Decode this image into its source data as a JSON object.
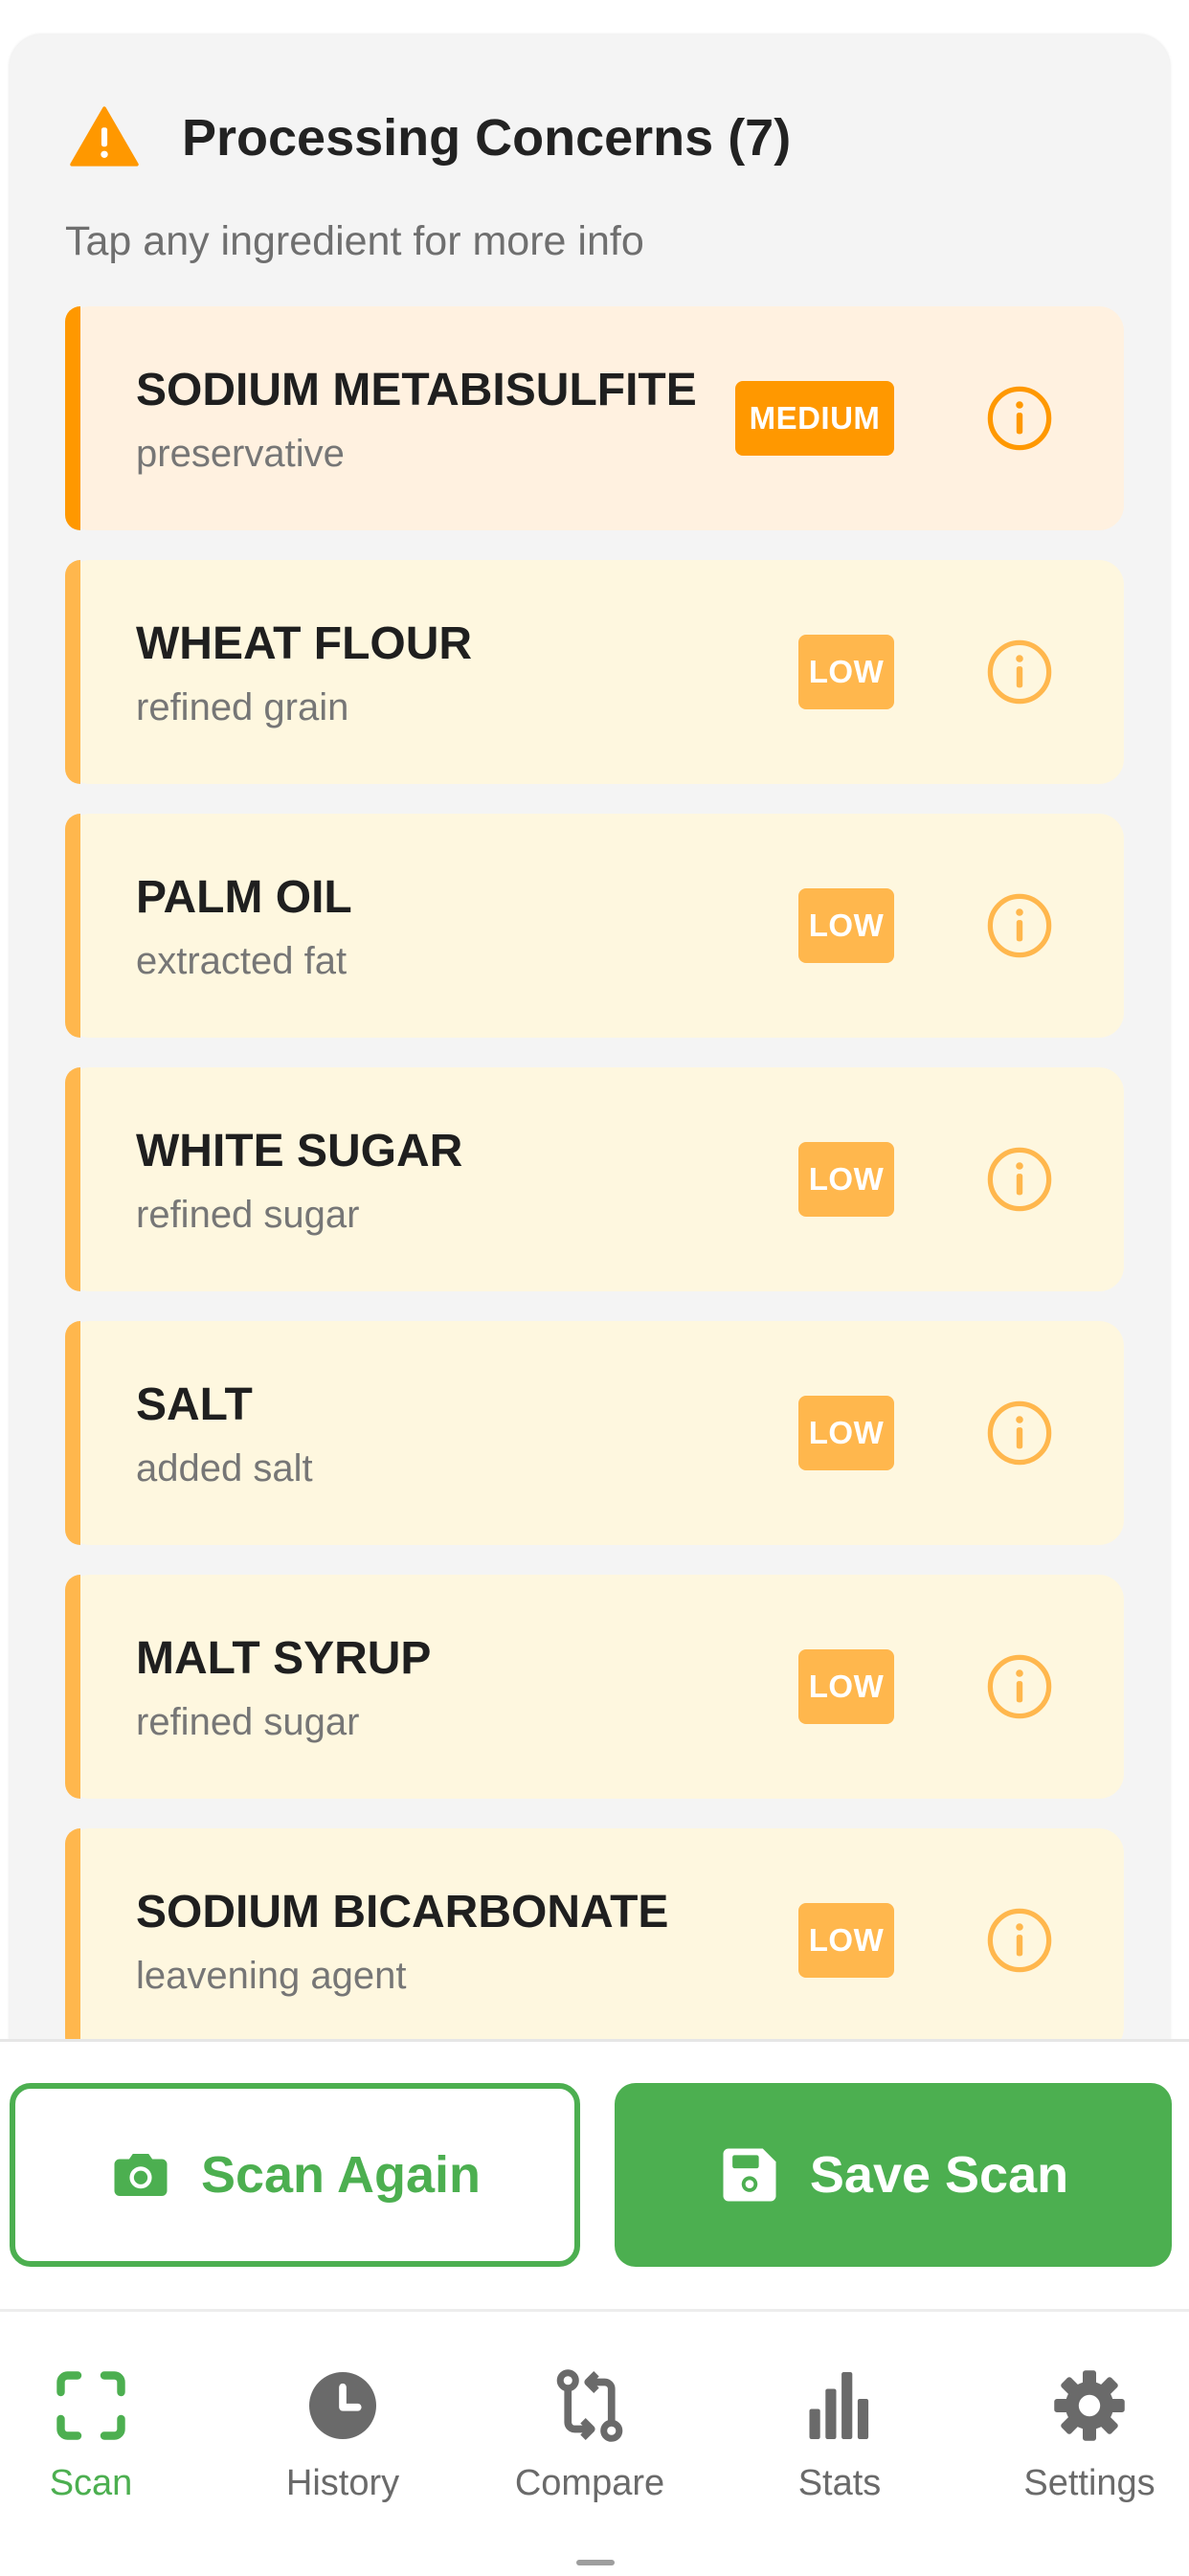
{
  "colors": {
    "accent_green": "#4caf50",
    "medium_orange": "#ff9800",
    "low_amber": "#ffb74d",
    "medium_bg": "#fff1e0",
    "low_bg": "#fef7df",
    "nav_inactive": "#6a6a6a"
  },
  "concerns": {
    "title": "Processing Concerns (7)",
    "subtitle": "Tap any ingredient for more info",
    "items": [
      {
        "name": "SODIUM METABISULFITE",
        "category": "preservative",
        "level": "MEDIUM"
      },
      {
        "name": "WHEAT FLOUR",
        "category": "refined grain",
        "level": "LOW"
      },
      {
        "name": "PALM OIL",
        "category": "extracted fat",
        "level": "LOW"
      },
      {
        "name": "WHITE SUGAR",
        "category": "refined sugar",
        "level": "LOW"
      },
      {
        "name": "SALT",
        "category": "added salt",
        "level": "LOW"
      },
      {
        "name": "MALT SYRUP",
        "category": "refined sugar",
        "level": "LOW"
      },
      {
        "name": "SODIUM BICARBONATE",
        "category": "leavening agent",
        "level": "LOW"
      }
    ]
  },
  "actions": {
    "scan_again": "Scan Again",
    "save_scan": "Save Scan"
  },
  "nav": {
    "items": [
      {
        "label": "Scan",
        "icon": "scan-frame-icon",
        "active": true
      },
      {
        "label": "History",
        "icon": "clock-icon",
        "active": false
      },
      {
        "label": "Compare",
        "icon": "compare-arrows-icon",
        "active": false
      },
      {
        "label": "Stats",
        "icon": "bar-chart-icon",
        "active": false
      },
      {
        "label": "Settings",
        "icon": "gear-icon",
        "active": false
      }
    ]
  }
}
